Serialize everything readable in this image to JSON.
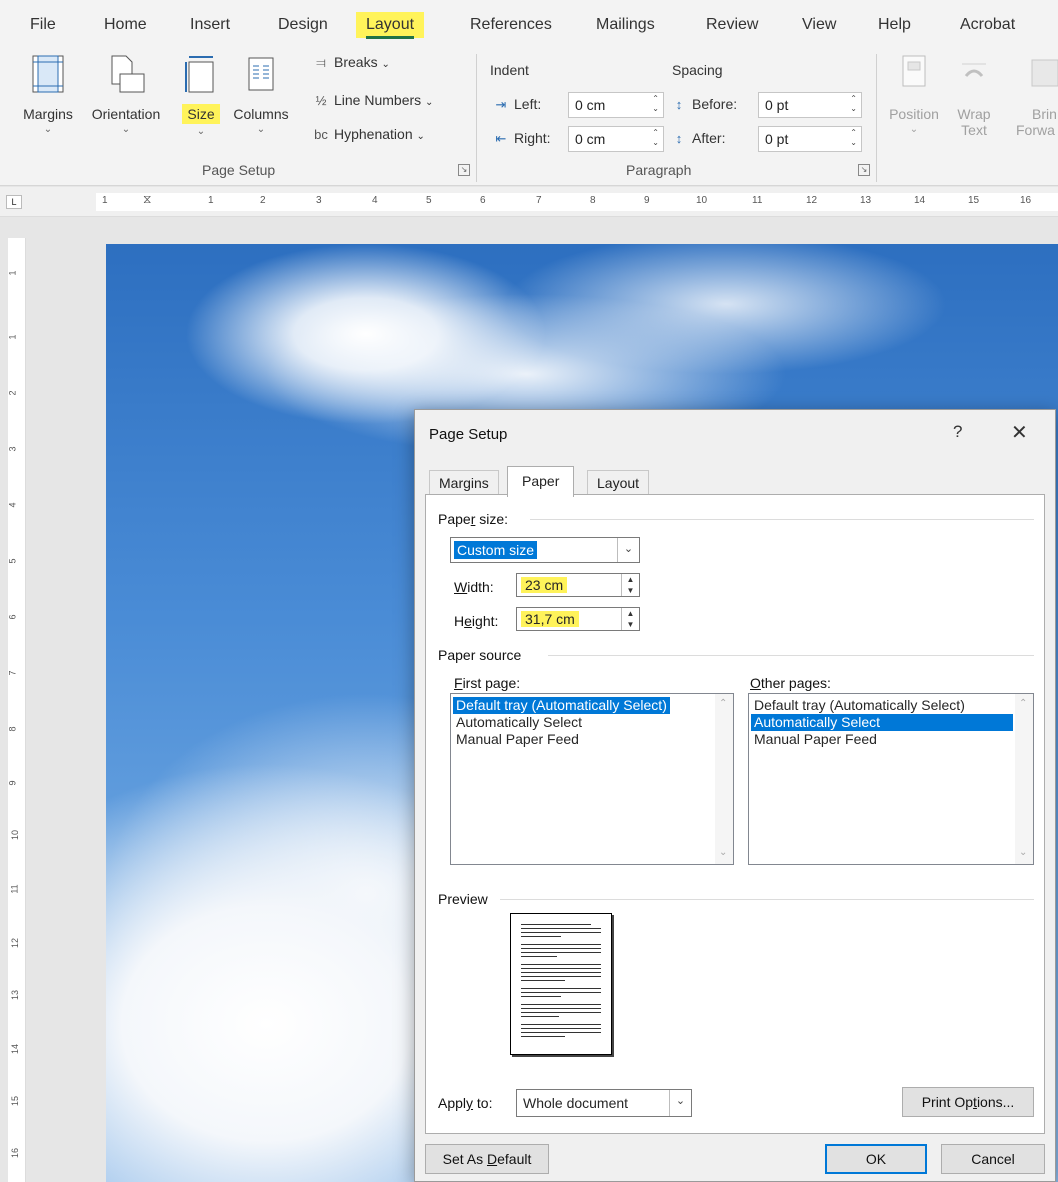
{
  "ribbon_tabs": [
    "File",
    "Home",
    "Insert",
    "Design",
    "Layout",
    "References",
    "Mailings",
    "Review",
    "View",
    "Help",
    "Acrobat"
  ],
  "ribbon": {
    "margins": "Margins",
    "orientation": "Orientation",
    "size": "Size",
    "columns": "Columns",
    "breaks": "Breaks",
    "line_numbers": "Line Numbers",
    "hyphenation": "Hyphenation",
    "page_setup_group": "Page Setup",
    "indent_header": "Indent",
    "spacing_header": "Spacing",
    "left_label": "Left:",
    "left_value": "0 cm",
    "right_label": "Right:",
    "right_value": "0 cm",
    "before_label": "Before:",
    "before_value": "0 pt",
    "after_label": "After:",
    "after_value": "0 pt",
    "paragraph_group": "Paragraph",
    "position": "Position",
    "wrap_line1": "Wrap",
    "wrap_line2": "Text",
    "bring_line1": "Brin",
    "bring_line2": "Forwa"
  },
  "ruler": {
    "h_ticks": [
      "1",
      "1",
      "2",
      "3",
      "4",
      "5",
      "6",
      "7",
      "8",
      "9",
      "10",
      "11",
      "12",
      "13",
      "14",
      "15",
      "16"
    ],
    "v_ticks": [
      "1",
      "1",
      "2",
      "3",
      "4",
      "5",
      "6",
      "7",
      "8",
      "9",
      "10",
      "11",
      "12",
      "13",
      "14",
      "15",
      "16"
    ]
  },
  "dialog": {
    "title": "Page Setup",
    "help": "?",
    "close": "✕",
    "tabs": [
      "Margins",
      "Paper",
      "Layout"
    ],
    "paper_size_label_pre": "Pape",
    "paper_size_label_u": "r",
    "paper_size_label_post": " size:",
    "paper_size_value": "Custom size",
    "width_label_u": "W",
    "width_label_rest": "idth:",
    "width_value": "23 cm",
    "height_label_pre": "H",
    "height_label_u": "e",
    "height_label_rest": "ight:",
    "height_value": "31,7 cm",
    "paper_source_label": "Paper source",
    "first_page_label_u": "F",
    "first_page_label_rest": "irst page:",
    "first_page_items": [
      "Default tray (Automatically Select)",
      "Automatically Select",
      "Manual Paper Feed"
    ],
    "other_pages_label_u": "O",
    "other_pages_label_rest": "ther pages:",
    "other_pages_items": [
      "Default tray (Automatically Select)",
      "Automatically Select",
      "Manual Paper Feed"
    ],
    "preview_label": "Preview",
    "apply_to_label_pre": "Appl",
    "apply_to_label_u": "y",
    "apply_to_label_post": " to:",
    "apply_to_value": "Whole document",
    "print_options_pre": "Print Op",
    "print_options_u": "t",
    "print_options_post": "ions...",
    "set_default_pre": "Set As ",
    "set_default_u": "D",
    "set_default_post": "efault",
    "ok": "OK",
    "cancel": "Cancel"
  },
  "colors": {
    "highlight": "#fff35a",
    "selection": "#0078d7",
    "accent_green": "#217346"
  }
}
